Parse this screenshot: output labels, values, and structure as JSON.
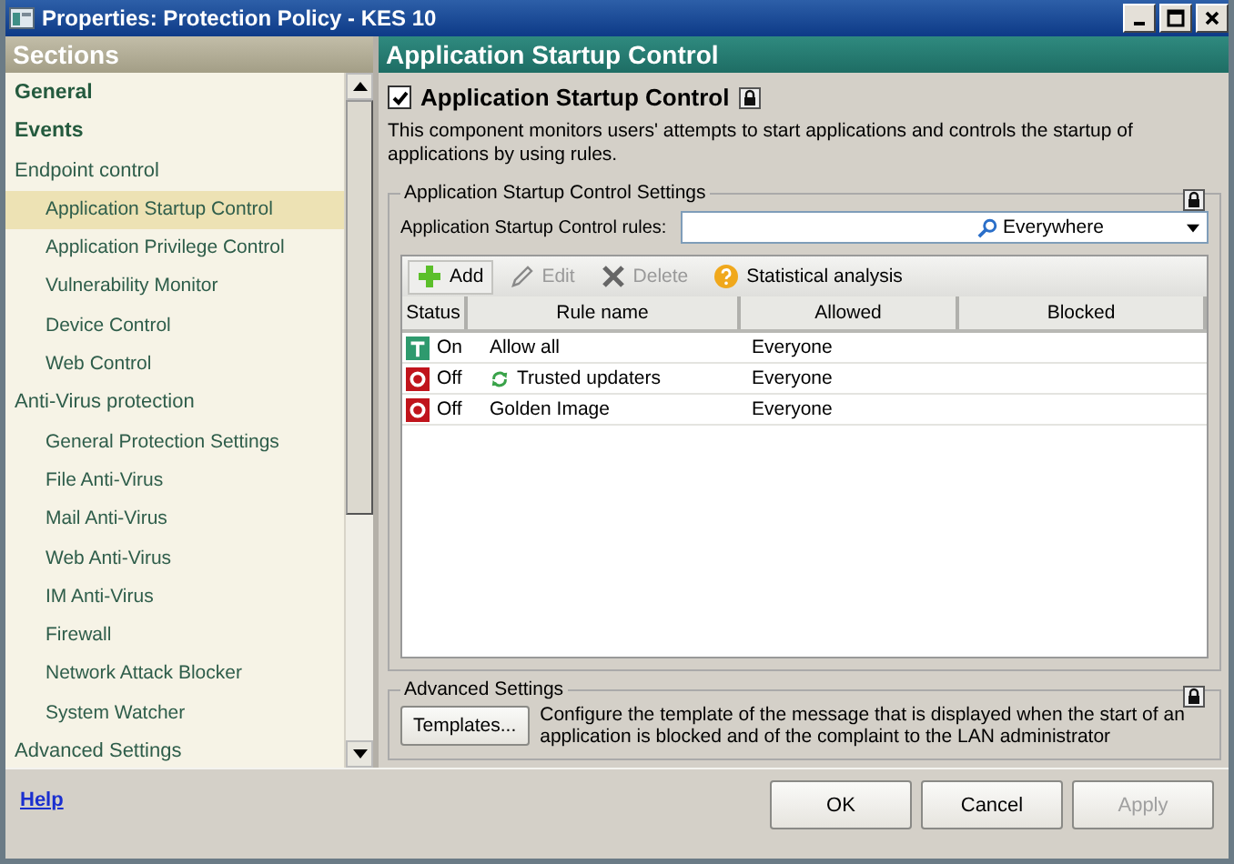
{
  "window": {
    "title": "Properties: Protection Policy - KES 10"
  },
  "sidebar": {
    "title": "Sections",
    "items": [
      {
        "label": "General",
        "kind": "page",
        "selected": false
      },
      {
        "label": "Events",
        "kind": "page",
        "selected": false
      },
      {
        "label": "Endpoint control",
        "kind": "group",
        "selected": false,
        "children": [
          {
            "label": "Application Startup Control",
            "selected": true
          },
          {
            "label": "Application Privilege Control",
            "selected": false
          },
          {
            "label": "Vulnerability Monitor",
            "selected": false
          },
          {
            "label": "Device Control",
            "selected": false
          },
          {
            "label": "Web Control",
            "selected": false
          }
        ]
      },
      {
        "label": "Anti-Virus protection",
        "kind": "group",
        "selected": false,
        "children": [
          {
            "label": "General Protection Settings",
            "selected": false
          },
          {
            "label": "File Anti-Virus",
            "selected": false
          },
          {
            "label": "Mail Anti-Virus",
            "selected": false
          },
          {
            "label": "Web Anti-Virus",
            "selected": false
          },
          {
            "label": "IM Anti-Virus",
            "selected": false
          },
          {
            "label": "Firewall",
            "selected": false
          },
          {
            "label": "Network Attack Blocker",
            "selected": false
          },
          {
            "label": "System Watcher",
            "selected": false
          }
        ]
      },
      {
        "label": "Advanced Settings",
        "kind": "group",
        "selected": false
      }
    ]
  },
  "panel": {
    "title": "Application Startup Control",
    "component": {
      "label": "Application Startup Control",
      "checked": true,
      "locked": true
    },
    "description": "This component monitors users' attempts to start applications and controls the startup of applications by using rules.",
    "settings": {
      "title": "Application Startup Control Settings",
      "locked": true,
      "rules_label": "Application Startup Control rules:",
      "filter": {
        "scope": "Everywhere"
      },
      "toolbar": [
        {
          "label": "Add",
          "kind": "add",
          "disabled": false
        },
        {
          "label": "Edit",
          "kind": "edit",
          "disabled": true
        },
        {
          "label": "Delete",
          "kind": "delete",
          "disabled": true
        },
        {
          "label": "Statistical analysis",
          "kind": "stats",
          "disabled": false
        }
      ],
      "columns": [
        "Status",
        "Rule name",
        "Allowed",
        "Blocked"
      ],
      "rows": [
        {
          "status": "On",
          "on": true,
          "name": "Allow all",
          "synced": false,
          "allowed": "Everyone"
        },
        {
          "status": "Off",
          "on": false,
          "name": "Trusted updaters",
          "synced": true,
          "allowed": "Everyone"
        },
        {
          "status": "Off",
          "on": false,
          "name": "Golden Image",
          "synced": false,
          "allowed": "Everyone"
        }
      ]
    },
    "advanced": {
      "title": "Advanced Settings",
      "locked": true,
      "button": "Templates...",
      "description": "Configure the template of the message that is displayed when the start of an application is blocked and of the complaint to the LAN administrator"
    }
  },
  "footer": {
    "help": "Help",
    "buttons": [
      {
        "label": "OK",
        "disabled": false
      },
      {
        "label": "Cancel",
        "disabled": false
      },
      {
        "label": "Apply",
        "disabled": true
      }
    ]
  }
}
